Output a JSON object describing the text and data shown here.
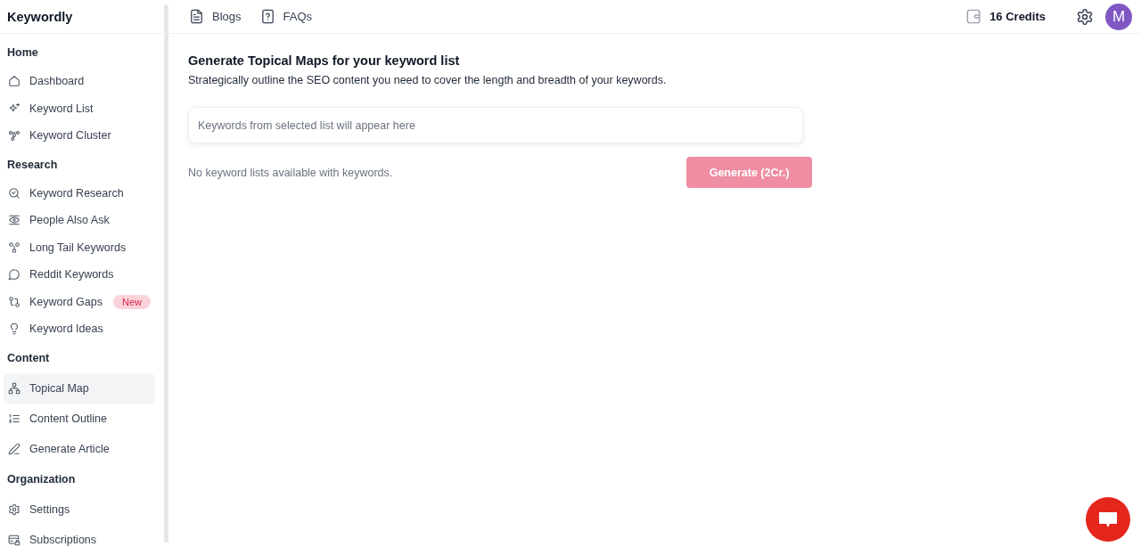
{
  "app": {
    "name": "Keywordly"
  },
  "sidebar": {
    "sections": [
      {
        "heading": "Home",
        "items": [
          {
            "label": "Dashboard",
            "selected": false
          },
          {
            "label": "Keyword List",
            "selected": false
          },
          {
            "label": "Keyword Cluster",
            "selected": false
          }
        ]
      },
      {
        "heading": "Research",
        "items": [
          {
            "label": "Keyword Research",
            "selected": false
          },
          {
            "label": "People Also Ask",
            "selected": false
          },
          {
            "label": "Long Tail Keywords",
            "selected": false
          },
          {
            "label": "Reddit Keywords",
            "selected": false
          },
          {
            "label": "Keyword Gaps",
            "selected": false,
            "badge": "New"
          },
          {
            "label": "Keyword Ideas",
            "selected": false
          }
        ]
      },
      {
        "heading": "Content",
        "items": [
          {
            "label": "Topical Map",
            "selected": true
          },
          {
            "label": "Content Outline",
            "selected": false
          },
          {
            "label": "Generate Article",
            "selected": false
          }
        ]
      },
      {
        "heading": "Organization",
        "items": [
          {
            "label": "Settings",
            "selected": false
          },
          {
            "label": "Subscriptions",
            "selected": false
          }
        ]
      }
    ]
  },
  "top_bar": {
    "links": [
      {
        "label": "Blogs"
      },
      {
        "label": "FAQs"
      }
    ],
    "credits": "16 Credits",
    "avatar_initial": "M"
  },
  "main": {
    "title": "Generate Topical Maps for your keyword list",
    "description": "Strategically outline the SEO content you need to cover the length and breadth of your keywords.",
    "keywords_field": {
      "placeholder": "Keywords from selected list will appear here"
    },
    "status_message": "No keyword lists available with keywords.",
    "generate_button": {
      "label": "Generate (2Cr.)",
      "disabled": true
    }
  }
}
